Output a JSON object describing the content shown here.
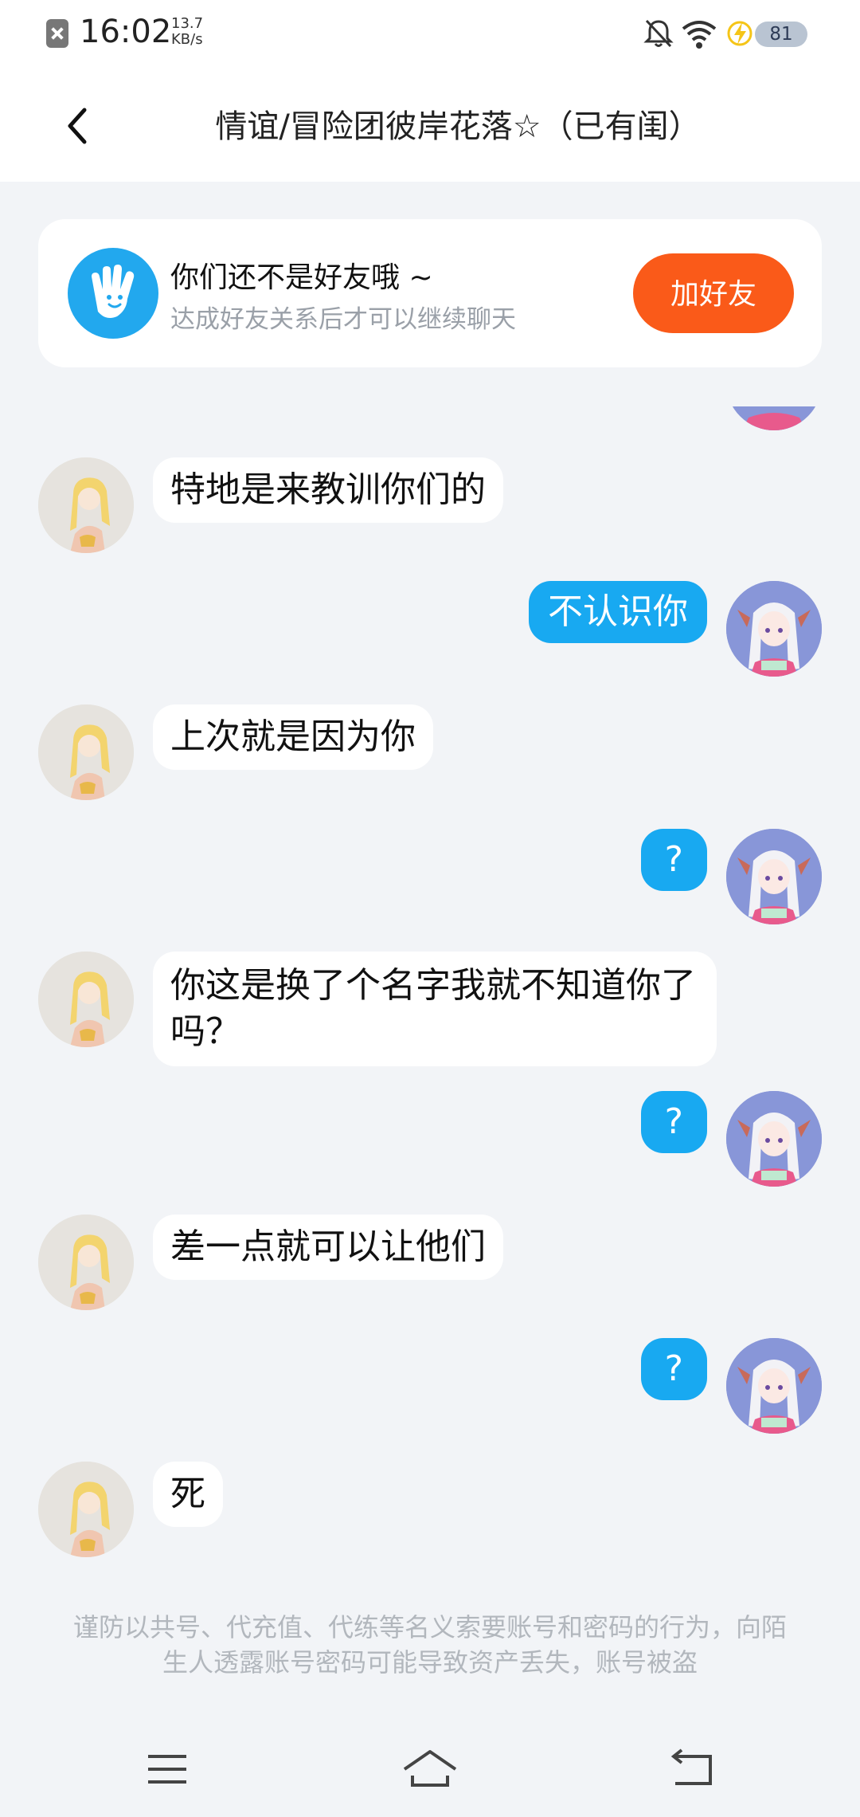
{
  "status_bar": {
    "time": "16:02",
    "speed_value": "13.7",
    "speed_unit": "KB/s",
    "battery": "81",
    "icons": [
      "notification-close-icon",
      "bell-muted-icon",
      "wifi-icon",
      "charging-icon",
      "battery-icon"
    ]
  },
  "header": {
    "title": "情谊/冒险团彼岸花落☆（已有闺）",
    "back_icon": "chevron-left-icon"
  },
  "friend_notice": {
    "title": "你们还不是好友哦 ~",
    "subtitle": "达成好友关系后才可以继续聊天",
    "button": "加好友",
    "icon": "hand-wave-icon",
    "colors": {
      "badge": "#22a8ee",
      "button": "#fa5a19"
    }
  },
  "messages": [
    {
      "side": "in",
      "text": "特地是来教训你们的"
    },
    {
      "side": "out",
      "text": "不认识你"
    },
    {
      "side": "in",
      "text": "上次就是因为你"
    },
    {
      "side": "out",
      "text": "?"
    },
    {
      "side": "in",
      "text": "你这是换了个名字我就不知道你了吗？"
    },
    {
      "side": "out",
      "text": "?"
    },
    {
      "side": "in",
      "text": "差一点就可以让他们"
    },
    {
      "side": "out",
      "text": "?"
    },
    {
      "side": "in",
      "text": "死"
    }
  ],
  "warning": "谨防以共号、代充值、代练等名义索要账号和密码的行为，向陌生人透露账号密码可能导致资产丢失，账号被盗",
  "nav": {
    "icons": [
      "menu-icon",
      "home-icon",
      "back-icon"
    ]
  },
  "colors": {
    "outgoing_bubble": "#18a9f1",
    "incoming_bubble": "#ffffff",
    "background": "#f2f4f7"
  }
}
